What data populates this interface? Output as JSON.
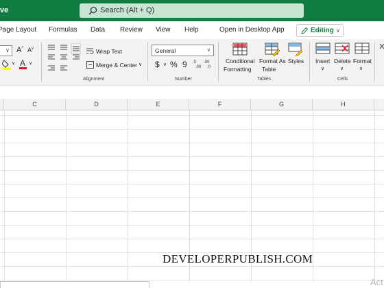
{
  "app": {
    "title_fragment": "ve"
  },
  "search": {
    "placeholder": "Search (Alt + Q)"
  },
  "tabs": {
    "page_layout": "Page Layout",
    "formulas": "Formulas",
    "data": "Data",
    "review": "Review",
    "view": "View",
    "help": "Help",
    "open_desktop": "Open in Desktop App",
    "editing": "Editing"
  },
  "ribbon": {
    "alignment": {
      "wrap_text": "Wrap Text",
      "merge_center": "Merge & Center",
      "label": "Alignment"
    },
    "number": {
      "format": "General",
      "currency": "$",
      "percent": "%",
      "comma": "9",
      "label": "Number"
    },
    "tables": {
      "conditional_formatting": [
        "Conditional",
        "Formatting"
      ],
      "format_as_table": [
        "Format As",
        "Table"
      ],
      "styles": "Styles",
      "label": "Tables"
    },
    "cells": {
      "insert": "Insert",
      "delete": "Delete",
      "format": "Format",
      "label": "Cells"
    }
  },
  "columns": [
    "C",
    "D",
    "E",
    "F",
    "G",
    "H"
  ],
  "watermark": "DEVELOPERPUBLISH.COM",
  "activate": "Act",
  "colors": {
    "brand": "#107c41",
    "search_bg": "#c8e4d3",
    "fill_yellow": "#ffff00",
    "font_red": "#e81123"
  }
}
